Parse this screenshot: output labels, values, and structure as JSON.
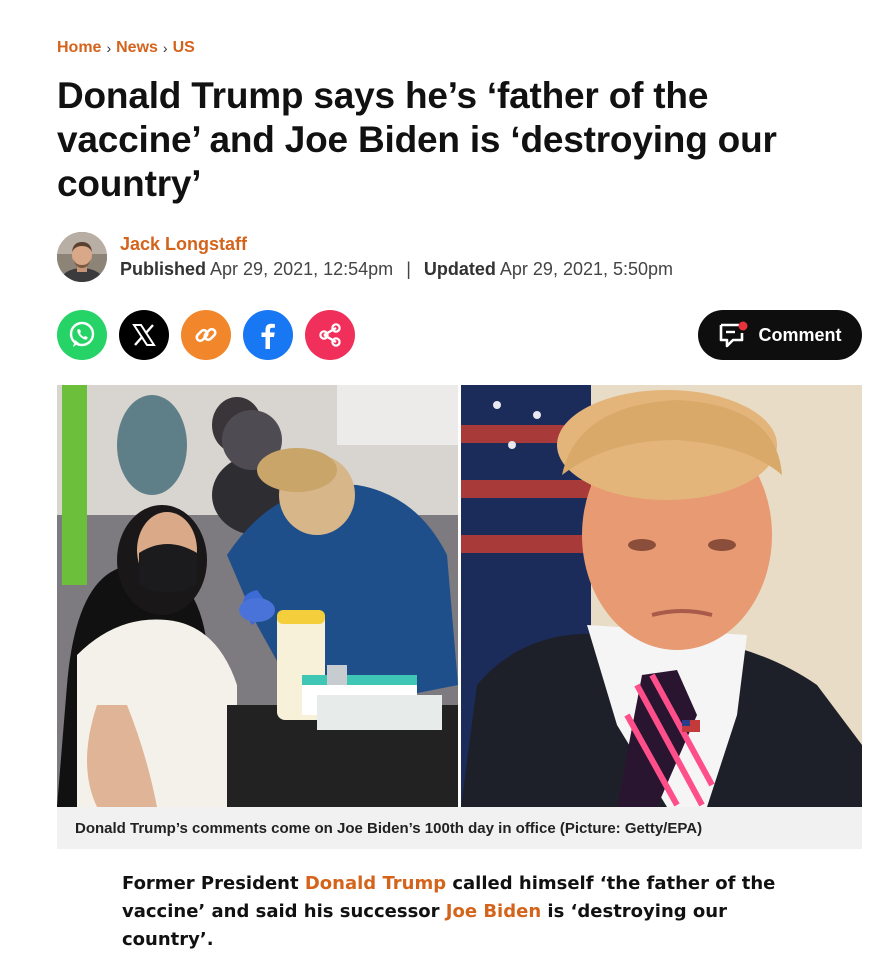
{
  "breadcrumb": {
    "home": "Home",
    "news": "News",
    "us": "US",
    "separator": "›"
  },
  "headline": "Donald Trump says he’s ‘father of the vaccine’ and Joe Biden is ‘destroying our country’",
  "byline": {
    "author": "Jack Longstaff",
    "published_label": "Published",
    "published_date": "Apr 29, 2021, 12:54pm",
    "separator": "|",
    "updated_label": "Updated",
    "updated_date": "Apr 29, 2021, 5:50pm"
  },
  "share": {
    "buttons": [
      {
        "name": "whatsapp",
        "icon": "whatsapp-icon",
        "color": "#25d366"
      },
      {
        "name": "x",
        "icon": "x-icon",
        "color": "#000000"
      },
      {
        "name": "copy-link",
        "icon": "link-icon",
        "color": "#f2862b"
      },
      {
        "name": "facebook",
        "icon": "facebook-icon",
        "color": "#1877f2"
      },
      {
        "name": "share",
        "icon": "share-icon",
        "color": "#f0305a"
      }
    ]
  },
  "comment": {
    "label": "Comment",
    "icon": "comment-icon",
    "badge_color": "#e8323c"
  },
  "image": {
    "caption": "Donald Trump’s comments come on Joe Biden’s 100th day in office (Picture: Getty/EPA)"
  },
  "lead": {
    "text1": "Former President ",
    "link1": "Donald Trump",
    "text2": " called himself ‘the father of the vaccine’ and said his successor ",
    "link2": "Joe Biden",
    "text3": " is ‘destroying our country’."
  },
  "colors": {
    "accent": "#d4641c",
    "text": "#111111",
    "caption_bg": "#f1f1f1"
  }
}
